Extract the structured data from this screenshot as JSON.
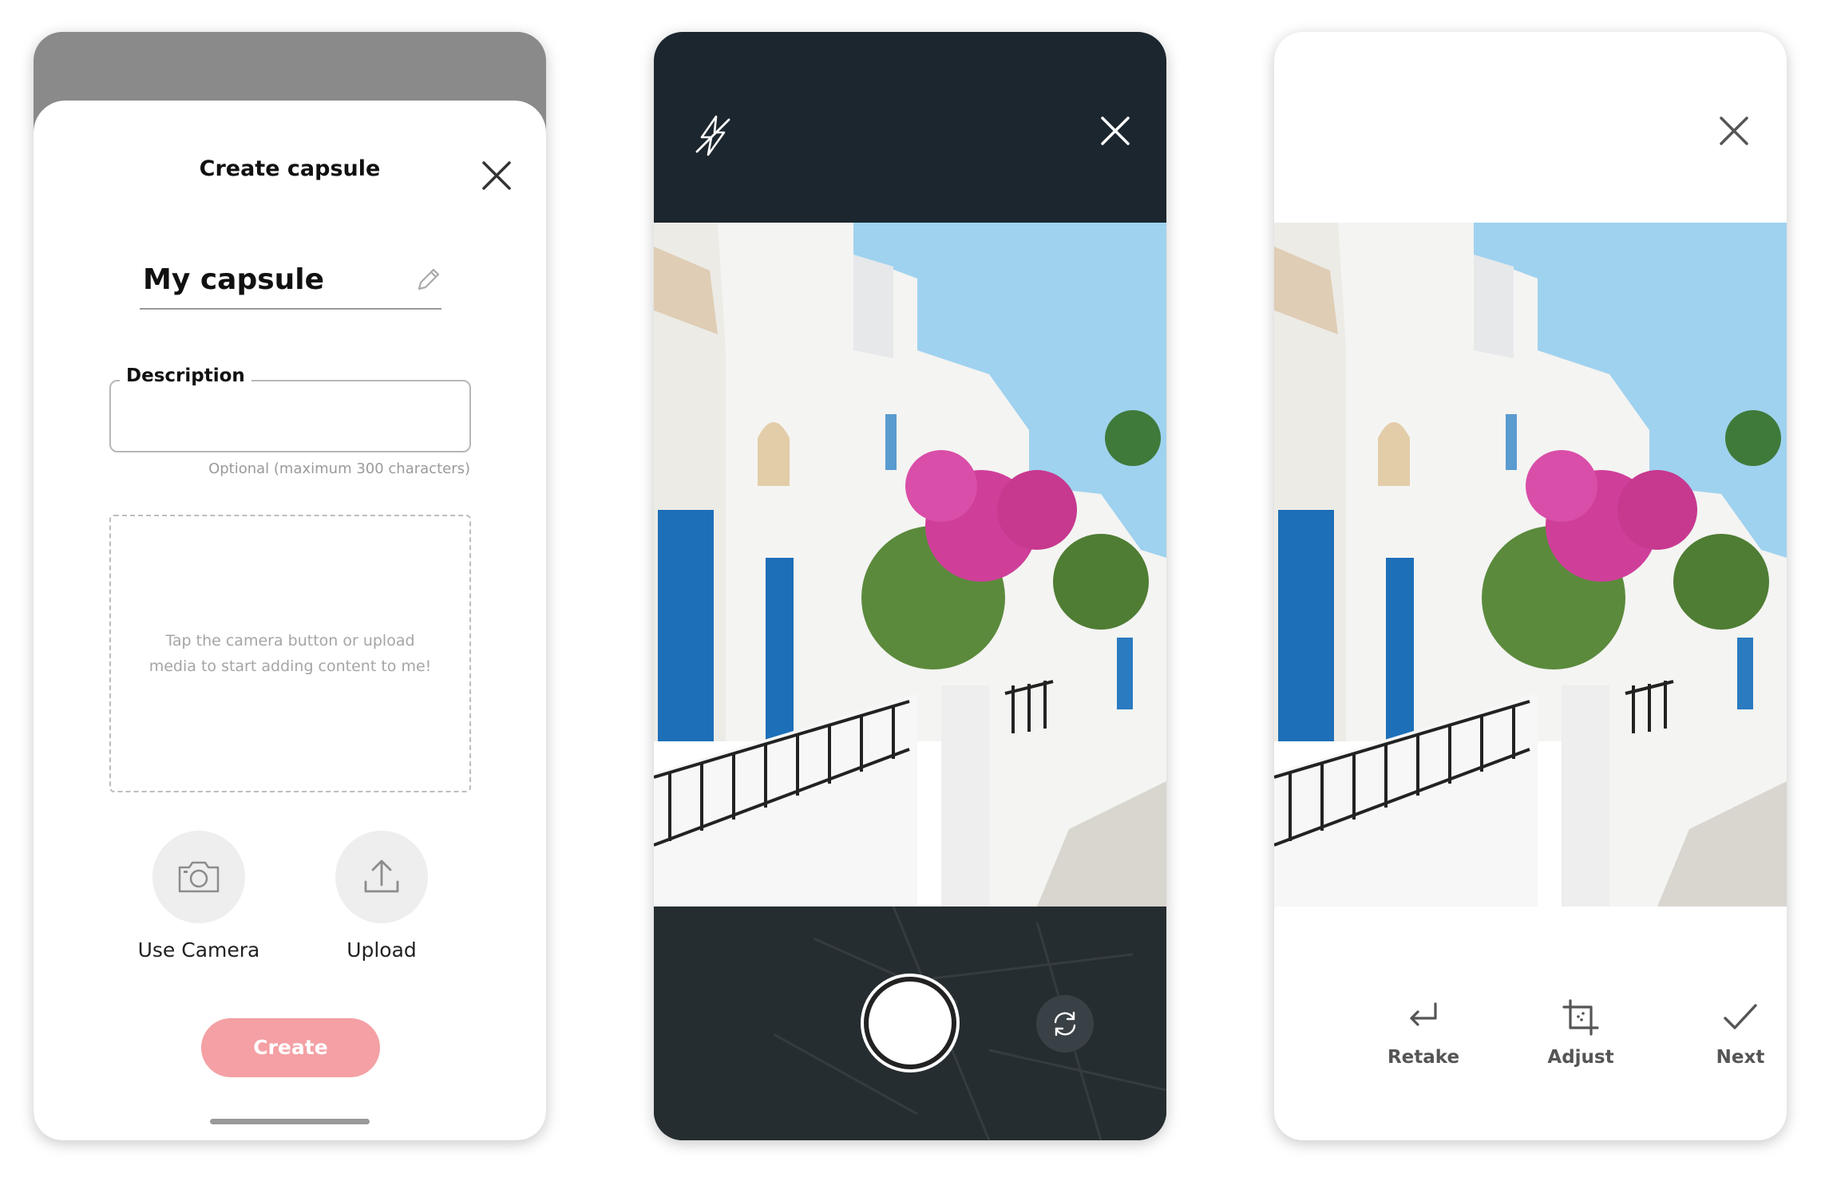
{
  "create_screen": {
    "title": "Create capsule",
    "capsule_name": "My capsule",
    "description_label": "Description",
    "description_value": "",
    "description_hint": "Optional (maximum 300 characters)",
    "dropzone_text": "Tap the camera button or upload\nmedia to start adding content to me!",
    "camera_label": "Use Camera",
    "upload_label": "Upload",
    "create_label": "Create",
    "accent_color": "#f4a0a4"
  },
  "camera_screen": {
    "icons": [
      "flash-off-icon",
      "close-icon",
      "shutter-button",
      "flip-camera-icon"
    ],
    "background_color": "#1c262e"
  },
  "review_screen": {
    "actions": [
      {
        "label": "Retake",
        "icon": "return-arrow-icon"
      },
      {
        "label": "Adjust",
        "icon": "crop-icon"
      },
      {
        "label": "Next",
        "icon": "checkmark-icon"
      }
    ]
  }
}
